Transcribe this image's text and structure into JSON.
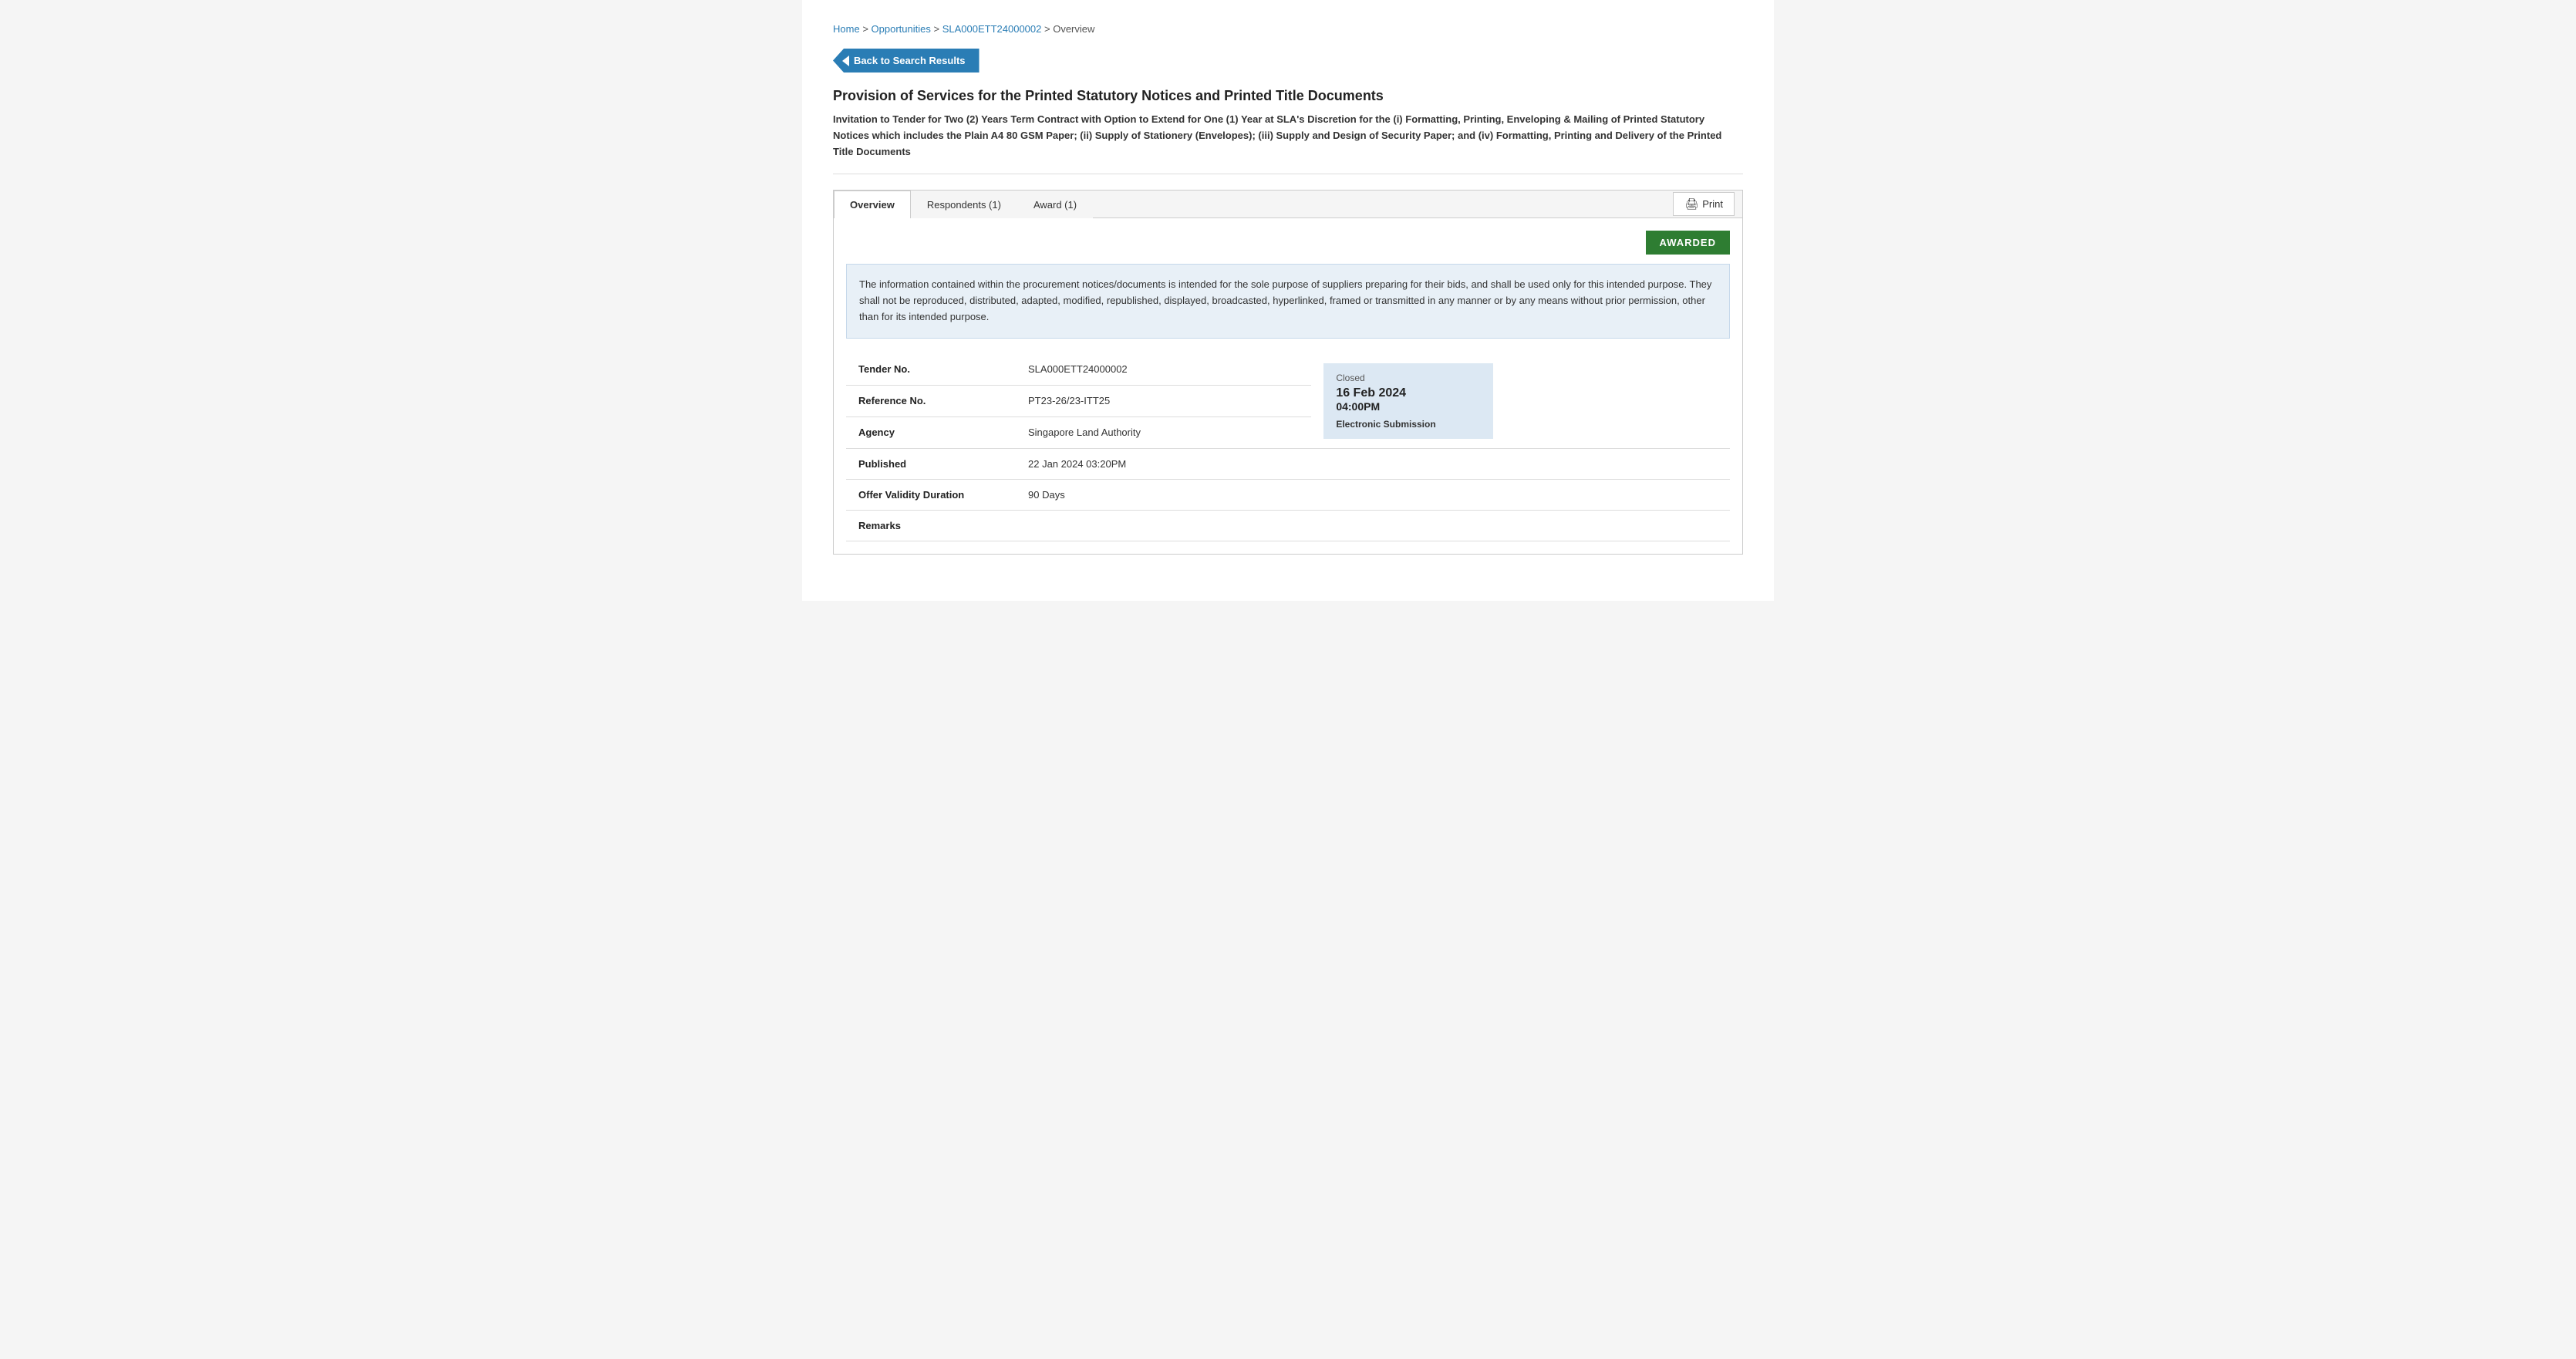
{
  "breadcrumb": {
    "home": "Home",
    "opportunities": "Opportunities",
    "tender_id": "SLA000ETT24000002",
    "current": "Overview"
  },
  "back_button": {
    "label": "Back to Search Results"
  },
  "title": "Provision of Services for the Printed Statutory Notices and Printed Title Documents",
  "description": "Invitation to Tender for Two (2) Years Term Contract with Option to Extend for One (1) Year at SLA's Discretion for the (i) Formatting, Printing, Enveloping & Mailing of Printed Statutory Notices which includes the Plain A4 80 GSM Paper; (ii) Supply of Stationery (Envelopes); (iii) Supply and Design of Security Paper; and (iv) Formatting, Printing and Delivery of the Printed Title Documents",
  "tabs": [
    {
      "label": "Overview",
      "active": true,
      "id": "overview"
    },
    {
      "label": "Respondents (1)",
      "active": false,
      "id": "respondents"
    },
    {
      "label": "Award (1)",
      "active": false,
      "id": "award"
    }
  ],
  "print_button": "Print",
  "awarded_badge": "AWARDED",
  "info_notice": "The information contained within the procurement notices/documents is intended for the sole purpose of suppliers preparing for their bids, and shall be used only for this intended purpose. They shall not be reproduced, distributed, adapted, modified, republished, displayed, broadcasted, hyperlinked, framed or transmitted in any manner or by any means without prior permission, other than for its intended purpose.",
  "details": [
    {
      "label": "Tender No.",
      "value": "SLA000ETT24000002"
    },
    {
      "label": "Reference No.",
      "value": "PT23-26/23-ITT25"
    },
    {
      "label": "Agency",
      "value": "Singapore Land Authority"
    },
    {
      "label": "Published",
      "value": "22 Jan 2024 03:20PM"
    },
    {
      "label": "Offer Validity Duration",
      "value": "90 Days"
    },
    {
      "label": "Remarks",
      "value": ""
    }
  ],
  "closed_box": {
    "label": "Closed",
    "date": "16 Feb 2024",
    "time": "04:00PM",
    "submission_type": "Electronic Submission"
  }
}
